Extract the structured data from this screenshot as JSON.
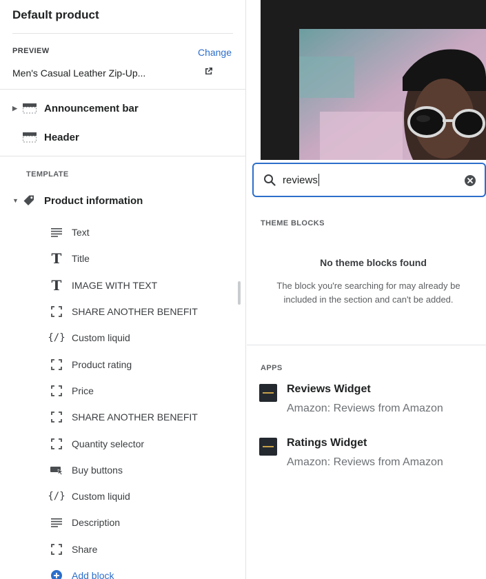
{
  "sidebar": {
    "title": "Default product",
    "preview": {
      "label": "PREVIEW",
      "change_label": "Change",
      "product_name": "Men's Casual Leather Zip-Up..."
    },
    "sections": [
      {
        "label": "Announcement bar",
        "icon": "layout-section-icon"
      },
      {
        "label": "Header",
        "icon": "layout-section-icon"
      }
    ],
    "template_label": "TEMPLATE",
    "product_section": {
      "label": "Product information",
      "icon": "tag-icon"
    },
    "blocks": [
      {
        "label": "Text",
        "icon": "text-lines-icon"
      },
      {
        "label": "Title",
        "icon": "title-t-icon"
      },
      {
        "label": "IMAGE WITH TEXT",
        "icon": "title-t-icon"
      },
      {
        "label": "SHARE ANOTHER BENEFIT",
        "icon": "block-frame-icon"
      },
      {
        "label": "Custom liquid",
        "icon": "liquid-code-icon"
      },
      {
        "label": "Product rating",
        "icon": "block-frame-icon"
      },
      {
        "label": "Price",
        "icon": "block-frame-icon"
      },
      {
        "label": "SHARE ANOTHER BENEFIT",
        "icon": "block-frame-icon"
      },
      {
        "label": "Quantity selector",
        "icon": "block-frame-icon"
      },
      {
        "label": "Buy buttons",
        "icon": "buy-button-icon"
      },
      {
        "label": "Custom liquid",
        "icon": "liquid-code-icon"
      },
      {
        "label": "Description",
        "icon": "text-lines-icon"
      },
      {
        "label": "Share",
        "icon": "block-frame-icon"
      }
    ],
    "add_block_label": "Add block"
  },
  "search": {
    "value": "reviews"
  },
  "results": {
    "theme_blocks_label": "THEME BLOCKS",
    "empty_title": "No theme blocks found",
    "empty_desc": "The block you're searching for may already be included in the section and can't be added.",
    "apps_label": "APPS",
    "apps": [
      {
        "name": "Reviews Widget",
        "source": "Amazon: Reviews from Amazon"
      },
      {
        "name": "Ratings Widget",
        "source": "Amazon: Reviews from Amazon"
      }
    ]
  },
  "colors": {
    "accent": "#2c6ecb",
    "text": "#202223",
    "muted": "#5c5f62",
    "preview_bg": "#1c1c1c"
  }
}
